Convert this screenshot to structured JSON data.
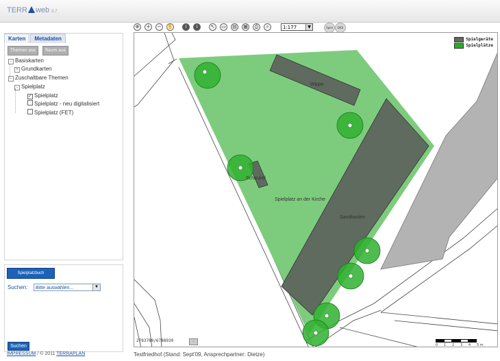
{
  "app": {
    "logo_text": "TERRAweb",
    "logo_left": "TERR",
    "logo_right": "web",
    "version": "3.7"
  },
  "left_panel": {
    "tabs": [
      {
        "label": "Karten",
        "active": false
      },
      {
        "label": "Metadaten",
        "active": true
      }
    ],
    "buttons": {
      "themen": "Themen aus",
      "raum": "Raum aus"
    },
    "tree": [
      {
        "label": "Basiskarten",
        "type": "expander",
        "state": "-"
      },
      {
        "label": "Grundkarten",
        "type": "expander",
        "state": "+"
      },
      {
        "label": "Zuschaltbare Themen",
        "type": "expander",
        "state": "-"
      },
      {
        "label": "Spielplatz",
        "type": "expander",
        "state": "-"
      },
      {
        "label": "Spielplatz",
        "type": "checkbox",
        "checked": true
      },
      {
        "label": "Spielplatz - neu digitalisiert",
        "type": "checkbox",
        "checked": false
      },
      {
        "label": "Spielplatz (FET)",
        "type": "checkbox",
        "checked": false
      }
    ]
  },
  "search_panel": {
    "spielplatzbuch_button": "Spielplatzbuch",
    "suchen_label": "Suchen:",
    "select_value": "Bitte auswählen...",
    "suchen_button": "Suchen"
  },
  "footer": {
    "impressum": "IMPRESSUM",
    "copyright": "/ © 2011",
    "terraplan": "TERRAPLAN",
    "status": "Testfriedhof (Stand: Sept'09, Ansprechpartner: Dietze)"
  },
  "toolbar": {
    "scale_value": "1:177",
    "tools": [
      {
        "icon": "zoom-extent-icon",
        "glyph": "⊕"
      },
      {
        "icon": "zoom-in-icon",
        "glyph": "+"
      },
      {
        "icon": "zoom-out-icon",
        "glyph": "−"
      },
      {
        "icon": "pan-hand-icon",
        "glyph": "✋"
      },
      {
        "icon": "info-icon",
        "glyph": "i"
      },
      {
        "icon": "info-multi-icon",
        "glyph": "i"
      },
      {
        "icon": "select-icon",
        "glyph": "↖"
      },
      {
        "icon": "measure-icon",
        "glyph": "▭"
      },
      {
        "icon": "layers-icon",
        "glyph": "▤"
      },
      {
        "icon": "grid-icon",
        "glyph": "▦"
      },
      {
        "icon": "print-icon",
        "glyph": "⎙"
      },
      {
        "icon": "search-icon",
        "glyph": "⌕"
      }
    ],
    "badges": [
      "Spiel",
      "DIGI"
    ]
  },
  "map": {
    "legend": [
      {
        "label": "Spielgeräte",
        "color": "#5f6b5f"
      },
      {
        "label": "Spielplätze",
        "color": "#22b022"
      }
    ],
    "labels": {
      "wippe": "Wippe",
      "schaukel": "Schaukel",
      "spielplatz": "Spielplatz an der Kirche",
      "sandkasten": "Sandkasten"
    },
    "coordinates": "2783789/6788930",
    "coord_button": "..",
    "scalebar_numbers": [
      "0",
      "1",
      "2",
      "3",
      "4",
      "5 m"
    ],
    "colors": {
      "playground": "#7dcc7d",
      "equipment": "#5f6b5f",
      "trees": "#2fb02f",
      "building": "#b3b3b3"
    }
  }
}
